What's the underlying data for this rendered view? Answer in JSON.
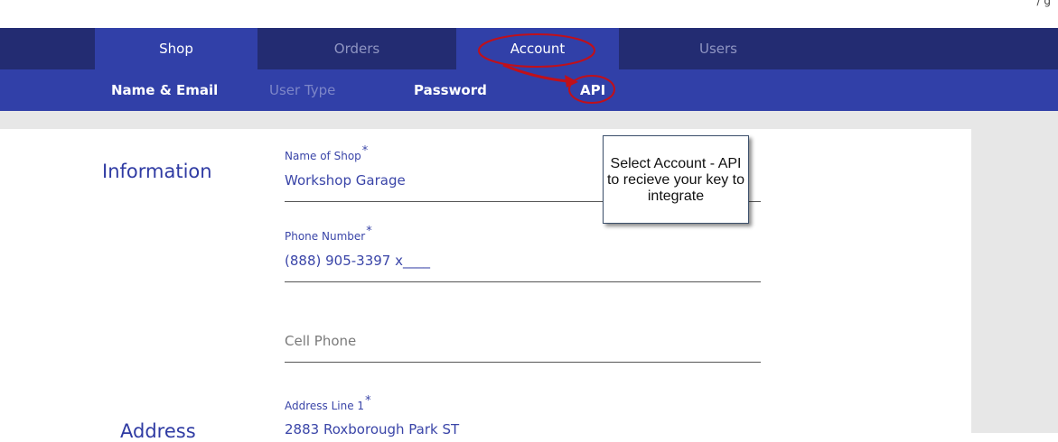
{
  "nav": {
    "tabs": [
      {
        "label": "Shop"
      },
      {
        "label": "Orders"
      },
      {
        "label": "Account"
      },
      {
        "label": "Users"
      }
    ]
  },
  "subnav": {
    "items": [
      {
        "label": "Name & Email"
      },
      {
        "label": "User Type"
      },
      {
        "label": "Password"
      },
      {
        "label": "API"
      }
    ]
  },
  "sections": {
    "information": "Information",
    "address": "Address"
  },
  "fields": {
    "shop_name": {
      "label": "Name of Shop",
      "required": "*",
      "value": "Workshop Garage"
    },
    "phone": {
      "label": "Phone Number",
      "required": "*",
      "value": "(888) 905-3397 x____"
    },
    "cell": {
      "placeholder": "Cell Phone"
    },
    "address1": {
      "label": "Address Line 1",
      "required": "*",
      "value": "2883 Roxborough Park ST"
    }
  },
  "callout": {
    "text": "Select Account - API to recieve your key to integrate"
  },
  "colors": {
    "nav_bg": "#232c72",
    "active_bg": "#3140a8",
    "annotation_red": "#c0101a"
  }
}
